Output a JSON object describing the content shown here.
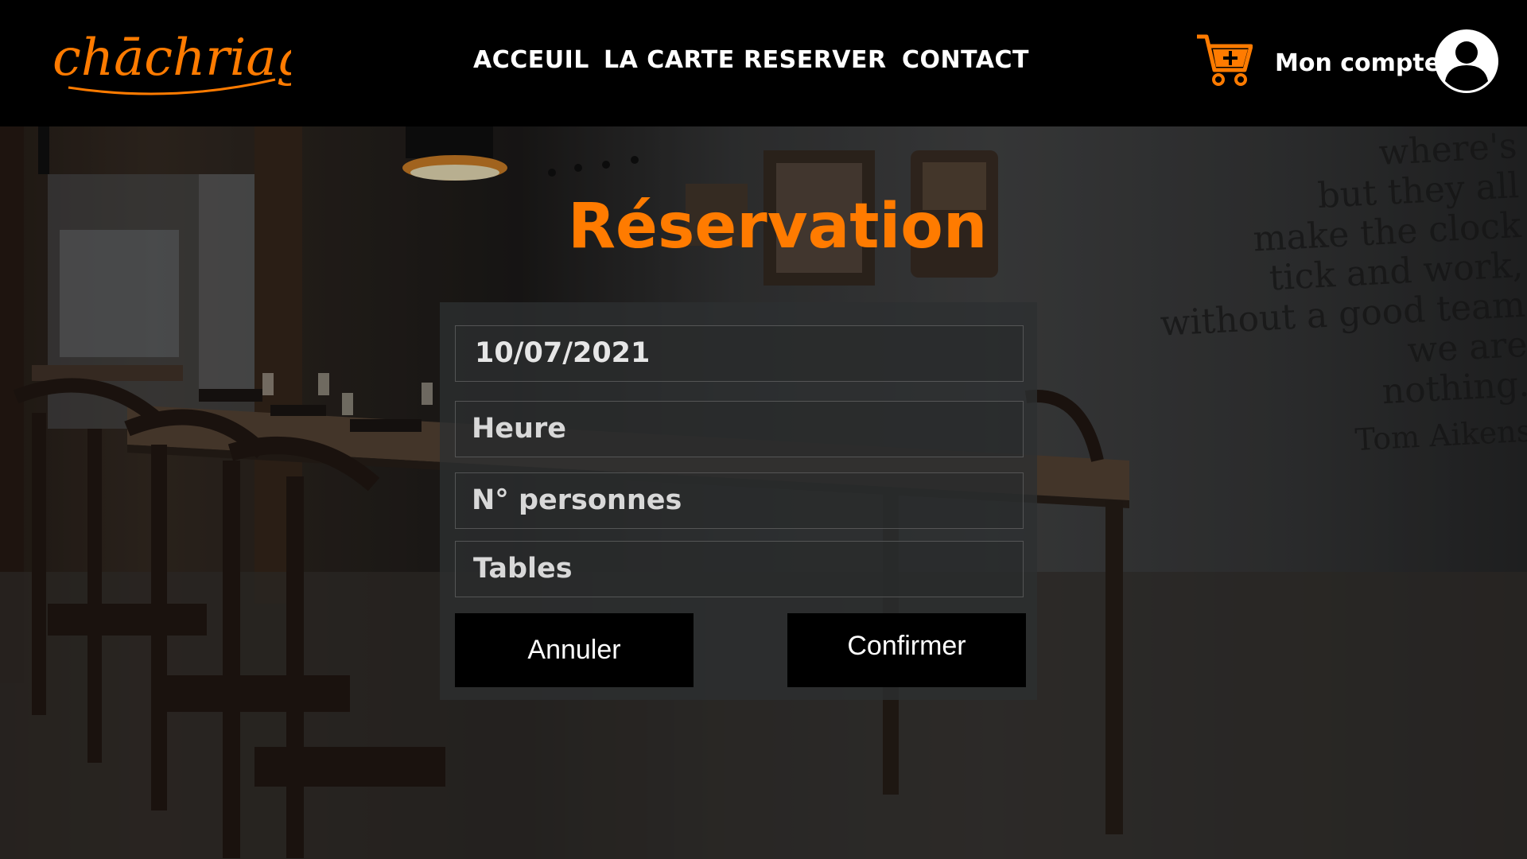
{
  "brand": {
    "logo_text": "chāchriaģ",
    "accent_color": "#ff7b00"
  },
  "nav": {
    "items": [
      {
        "label": "ACCEUIL"
      },
      {
        "label": "LA CARTE"
      },
      {
        "label": "RESERVER"
      },
      {
        "label": "CONTACT"
      }
    ]
  },
  "header": {
    "cart_icon": "cart-plus-icon",
    "account_label": "Mon compte",
    "account_icon": "user-circle-icon"
  },
  "wall_quote": {
    "lines": [
      "where's",
      "but they all",
      "make the clock",
      "tick and work,",
      "without a good team",
      "we are",
      "nothing."
    ],
    "author": "Tom Aikens"
  },
  "reservation": {
    "title": "Réservation",
    "date_value": "10/07/2021",
    "hour_placeholder": "Heure",
    "people_placeholder": "N° personnes",
    "tables_placeholder": "Tables",
    "cancel_label": "Annuler",
    "confirm_label": "Confirmer"
  }
}
